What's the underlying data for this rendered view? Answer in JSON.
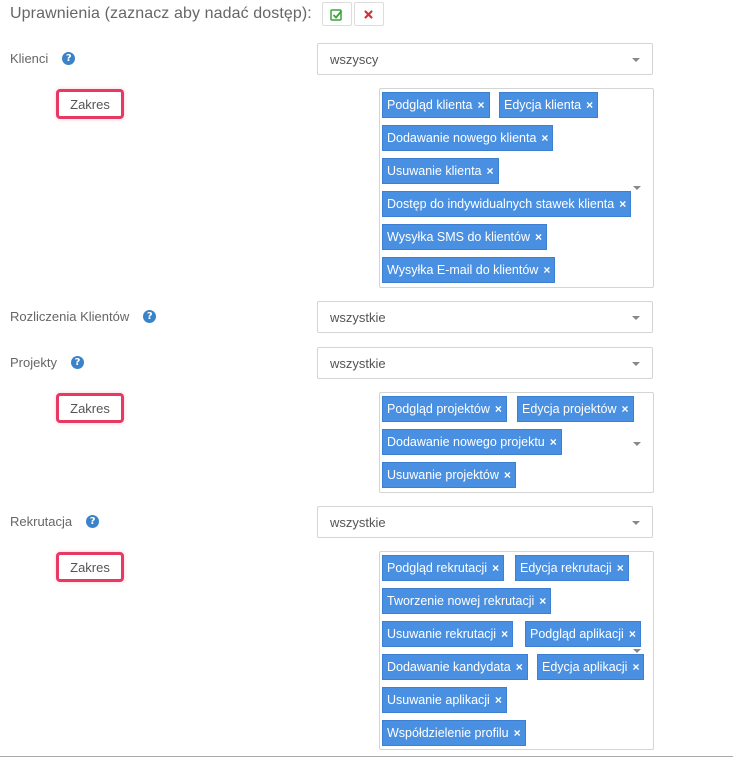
{
  "header": {
    "title": "Uprawnienia (zaznacz aby nadać dostęp):"
  },
  "sections": [
    {
      "label": "Klienci",
      "select_value": "wszyscy",
      "zakres": "Zakres",
      "tags": [
        "Podgląd klienta",
        "Edycja klienta",
        "Dodawanie nowego klienta",
        "Usuwanie klienta",
        "Dostęp do indywidualnych stawek klienta",
        "Wysyłka SMS do klientów",
        "Wysyłka E-mail do klientów"
      ]
    },
    {
      "label": "Rozliczenia Klientów",
      "select_value": "wszystkie"
    },
    {
      "label": "Projekty",
      "select_value": "wszystkie",
      "zakres": "Zakres",
      "tags": [
        "Podgląd projektów",
        "Edycja projektów",
        "Dodawanie nowego projektu",
        "Usuwanie projektów"
      ]
    },
    {
      "label": "Rekrutacja",
      "select_value": "wszystkie",
      "zakres": "Zakres",
      "tags": [
        "Podgląd rekrutacji",
        "Edycja rekrutacji",
        "Tworzenie nowej rekrutacji",
        "Usuwanie rekrutacji",
        "Podgląd aplikacji",
        "Dodawanie kandydata",
        "Edycja aplikacji",
        "Usuwanie aplikacji",
        "Współdzielenie profilu"
      ]
    }
  ],
  "icons": {
    "help": "help-icon",
    "tag_remove": "×",
    "check_all": "check-square-icon",
    "uncheck_all": "x-icon"
  },
  "colors": {
    "tag_bg": "#4a90e2",
    "highlight": "#e63a64",
    "help": "#3b83c8",
    "check_green": "#3aa53a",
    "x_red": "#d9322e"
  }
}
